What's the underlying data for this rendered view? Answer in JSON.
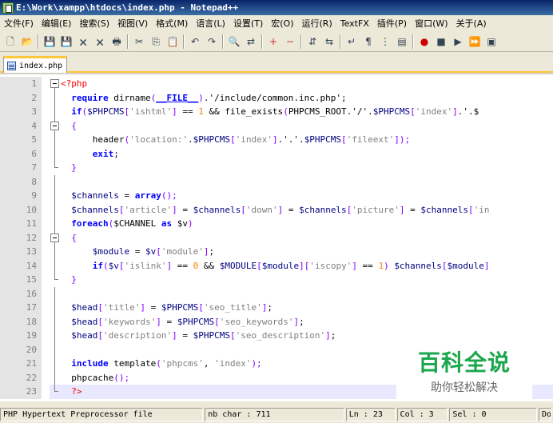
{
  "window": {
    "title": "E:\\Work\\xampp\\htdocs\\index.php - Notepad++"
  },
  "menu": [
    "文件(F)",
    "编辑(E)",
    "搜索(S)",
    "视图(V)",
    "格式(M)",
    "语言(L)",
    "设置(T)",
    "宏(O)",
    "运行(R)",
    "TextFX",
    "插件(P)",
    "窗口(W)",
    "关于(A)"
  ],
  "toolbar": {
    "icons": [
      "new-file-icon",
      "open-icon",
      "save-icon",
      "save-all-icon",
      "close-icon",
      "close-all-icon",
      "print-icon",
      "cut-icon",
      "copy-icon",
      "paste-icon",
      "undo-icon",
      "redo-icon",
      "find-icon",
      "replace-icon",
      "zoom-in-icon",
      "zoom-out-icon",
      "sync-v-icon",
      "sync-h-icon",
      "wrap-icon",
      "show-all-icon",
      "indent-guide-icon",
      "doc-map-icon",
      "record-icon",
      "stop-icon",
      "play-icon",
      "play-multi-icon",
      "save-macro-icon"
    ]
  },
  "tab": {
    "label": "index.php"
  },
  "editor": {
    "lines": [
      {
        "n": "1",
        "fold": "box",
        "t": [
          [
            "php",
            "<?php"
          ]
        ]
      },
      {
        "n": "2",
        "fold": "line",
        "t": [
          [
            "",
            "  "
          ],
          [
            "kw",
            "require"
          ],
          [
            "",
            " dirname"
          ],
          [
            "op",
            "("
          ],
          [
            "kw ul",
            "__FILE__"
          ],
          [
            "op",
            ")"
          ],
          [
            "",
            ".'/include/common.inc.php';"
          ]
        ]
      },
      {
        "n": "3",
        "fold": "line",
        "t": [
          [
            "",
            "  "
          ],
          [
            "kw",
            "if"
          ],
          [
            "op",
            "("
          ],
          [
            "var",
            "$PHPCMS"
          ],
          [
            "op",
            "["
          ],
          [
            "str",
            "'ishtml'"
          ],
          [
            "op",
            "]"
          ],
          [
            "",
            " == "
          ],
          [
            "num",
            "1"
          ],
          [
            "",
            " && file_exists"
          ],
          [
            "op",
            "("
          ],
          [
            "",
            "PHPCMS_ROOT.'/'."
          ],
          [
            "var",
            "$PHPCMS"
          ],
          [
            "op",
            "["
          ],
          [
            "str",
            "'index'"
          ],
          [
            "op",
            "]"
          ],
          [
            "",
            ".'.$"
          ]
        ]
      },
      {
        "n": "4",
        "fold": "box",
        "t": [
          [
            "op",
            "  {"
          ]
        ]
      },
      {
        "n": "5",
        "fold": "line",
        "t": [
          [
            "",
            "      header"
          ],
          [
            "op",
            "("
          ],
          [
            "str",
            "'location:'"
          ],
          [
            "",
            "."
          ],
          [
            "var",
            "$PHPCMS"
          ],
          [
            "op",
            "["
          ],
          [
            "str",
            "'index'"
          ],
          [
            "op",
            "]"
          ],
          [
            "",
            ".'.'."
          ],
          [
            "var",
            "$PHPCMS"
          ],
          [
            "op",
            "["
          ],
          [
            "str",
            "'fileext'"
          ],
          [
            "op",
            "]"
          ],
          [
            "op",
            ");"
          ]
        ]
      },
      {
        "n": "6",
        "fold": "line",
        "t": [
          [
            "",
            "      "
          ],
          [
            "kw",
            "exit"
          ],
          [
            "",
            ";"
          ]
        ]
      },
      {
        "n": "7",
        "fold": "end",
        "t": [
          [
            "op",
            "  }"
          ]
        ]
      },
      {
        "n": "8",
        "fold": "line",
        "t": []
      },
      {
        "n": "9",
        "fold": "line",
        "t": [
          [
            "",
            "  "
          ],
          [
            "var",
            "$channels"
          ],
          [
            "",
            " = "
          ],
          [
            "kw",
            "array"
          ],
          [
            "op",
            "();"
          ]
        ]
      },
      {
        "n": "10",
        "fold": "line",
        "t": [
          [
            "",
            "  "
          ],
          [
            "var",
            "$channels"
          ],
          [
            "op",
            "["
          ],
          [
            "str",
            "'article'"
          ],
          [
            "op",
            "]"
          ],
          [
            "",
            " = "
          ],
          [
            "var",
            "$channels"
          ],
          [
            "op",
            "["
          ],
          [
            "str",
            "'down'"
          ],
          [
            "op",
            "]"
          ],
          [
            "",
            " = "
          ],
          [
            "var",
            "$channels"
          ],
          [
            "op",
            "["
          ],
          [
            "str",
            "'picture'"
          ],
          [
            "op",
            "]"
          ],
          [
            "",
            " = "
          ],
          [
            "var",
            "$channels"
          ],
          [
            "op",
            "["
          ],
          [
            "str",
            "'in"
          ]
        ]
      },
      {
        "n": "11",
        "fold": "line",
        "t": [
          [
            "",
            "  "
          ],
          [
            "kw",
            "foreach"
          ],
          [
            "op",
            "("
          ],
          [
            "",
            "$CHANNEL "
          ],
          [
            "kw",
            "as"
          ],
          [
            "",
            " $v"
          ],
          [
            "op",
            ")"
          ]
        ]
      },
      {
        "n": "12",
        "fold": "box",
        "t": [
          [
            "op",
            "  {"
          ]
        ]
      },
      {
        "n": "13",
        "fold": "line",
        "t": [
          [
            "",
            "      "
          ],
          [
            "var",
            "$module"
          ],
          [
            "",
            " = "
          ],
          [
            "var",
            "$v"
          ],
          [
            "op",
            "["
          ],
          [
            "str",
            "'module'"
          ],
          [
            "op",
            "]"
          ],
          [
            "",
            ";"
          ]
        ]
      },
      {
        "n": "14",
        "fold": "line",
        "t": [
          [
            "",
            "      "
          ],
          [
            "kw",
            "if"
          ],
          [
            "op",
            "("
          ],
          [
            "var",
            "$v"
          ],
          [
            "op",
            "["
          ],
          [
            "str",
            "'islink'"
          ],
          [
            "op",
            "]"
          ],
          [
            "",
            " == "
          ],
          [
            "num",
            "0"
          ],
          [
            "",
            " && "
          ],
          [
            "var",
            "$MODULE"
          ],
          [
            "op",
            "["
          ],
          [
            "var",
            "$module"
          ],
          [
            "op",
            "]["
          ],
          [
            "str",
            "'iscopy'"
          ],
          [
            "op",
            "]"
          ],
          [
            "",
            " == "
          ],
          [
            "num",
            "1"
          ],
          [
            "op",
            ")"
          ],
          [
            "",
            " "
          ],
          [
            "var",
            "$channels"
          ],
          [
            "op",
            "["
          ],
          [
            "var",
            "$module"
          ],
          [
            "op",
            "]"
          ]
        ]
      },
      {
        "n": "15",
        "fold": "end",
        "t": [
          [
            "op",
            "  }"
          ]
        ]
      },
      {
        "n": "16",
        "fold": "line",
        "t": []
      },
      {
        "n": "17",
        "fold": "line",
        "t": [
          [
            "",
            "  "
          ],
          [
            "var",
            "$head"
          ],
          [
            "op",
            "["
          ],
          [
            "str",
            "'title'"
          ],
          [
            "op",
            "]"
          ],
          [
            "",
            " = "
          ],
          [
            "var",
            "$PHPCMS"
          ],
          [
            "op",
            "["
          ],
          [
            "str",
            "'seo_title'"
          ],
          [
            "op",
            "]"
          ],
          [
            "",
            ";"
          ]
        ]
      },
      {
        "n": "18",
        "fold": "line",
        "t": [
          [
            "",
            "  "
          ],
          [
            "var",
            "$head"
          ],
          [
            "op",
            "["
          ],
          [
            "str",
            "'keywords'"
          ],
          [
            "op",
            "]"
          ],
          [
            "",
            " = "
          ],
          [
            "var",
            "$PHPCMS"
          ],
          [
            "op",
            "["
          ],
          [
            "str",
            "'seo_keywords'"
          ],
          [
            "op",
            "]"
          ],
          [
            "",
            ";"
          ]
        ]
      },
      {
        "n": "19",
        "fold": "line",
        "t": [
          [
            "",
            "  "
          ],
          [
            "var",
            "$head"
          ],
          [
            "op",
            "["
          ],
          [
            "str",
            "'description'"
          ],
          [
            "op",
            "]"
          ],
          [
            "",
            " = "
          ],
          [
            "var",
            "$PHPCMS"
          ],
          [
            "op",
            "["
          ],
          [
            "str",
            "'seo_description'"
          ],
          [
            "op",
            "]"
          ],
          [
            "",
            ";"
          ]
        ]
      },
      {
        "n": "20",
        "fold": "line",
        "t": []
      },
      {
        "n": "21",
        "fold": "line",
        "t": [
          [
            "",
            "  "
          ],
          [
            "kw",
            "include"
          ],
          [
            "",
            " template"
          ],
          [
            "op",
            "("
          ],
          [
            "str",
            "'phpcms'"
          ],
          [
            "",
            ", "
          ],
          [
            "str",
            "'index'"
          ],
          [
            "op",
            ");"
          ]
        ]
      },
      {
        "n": "22",
        "fold": "line",
        "t": [
          [
            "",
            "  phpcache"
          ],
          [
            "op",
            "();"
          ]
        ]
      },
      {
        "n": "23",
        "fold": "end",
        "cur": true,
        "t": [
          [
            "php",
            "  ?>"
          ]
        ]
      }
    ]
  },
  "watermark": {
    "line1": "百科全说",
    "line2": "助你轻松解决"
  },
  "status": {
    "type": "PHP Hypertext Preprocessor file",
    "chars": "nb char : 711",
    "ln": "Ln : 23",
    "col": "Col : 3",
    "sel": "Sel : 0",
    "eol": "Dos"
  }
}
